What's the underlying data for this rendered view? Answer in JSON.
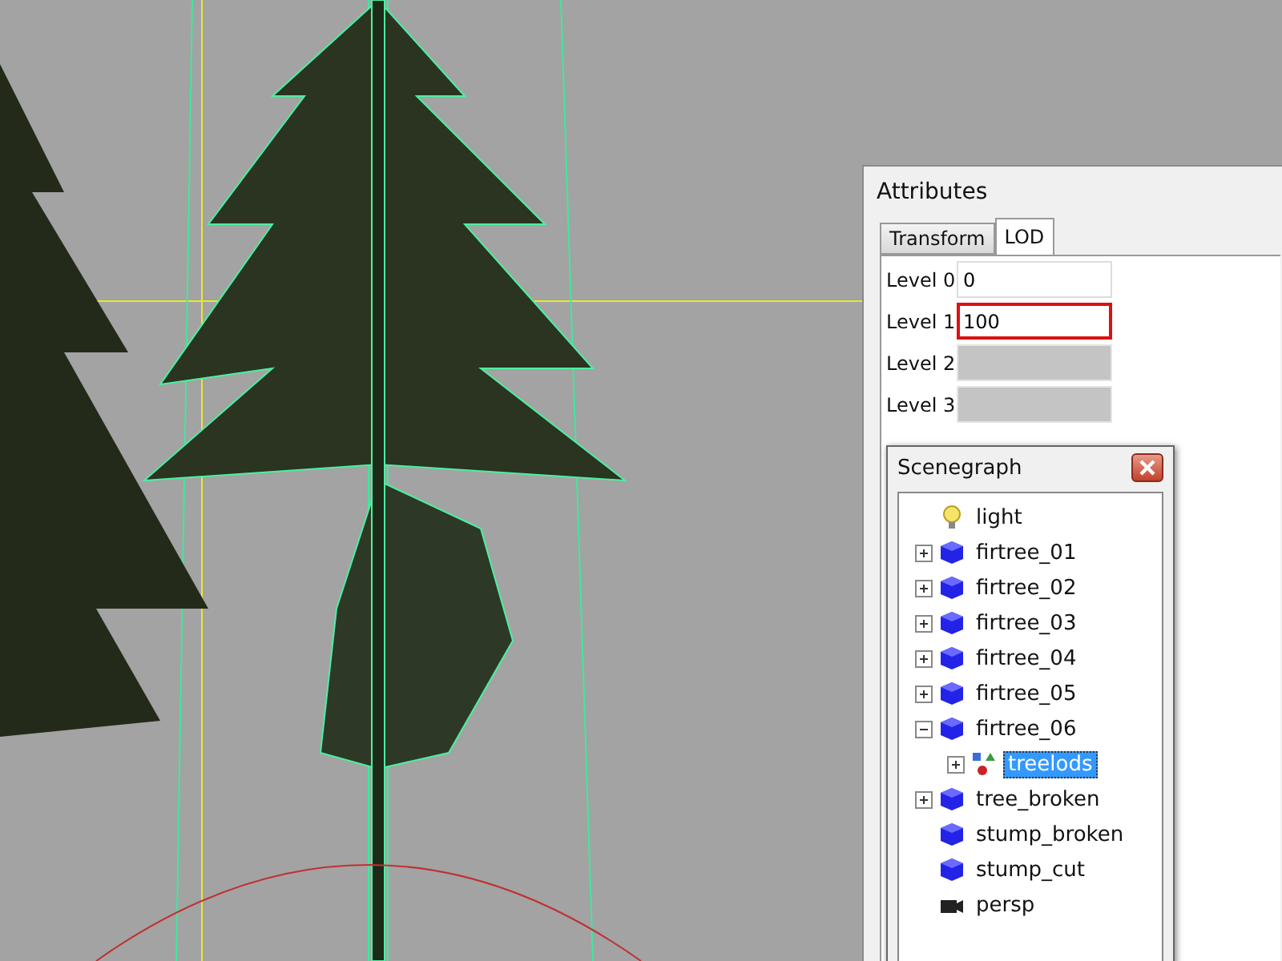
{
  "attributes": {
    "title": "Attributes",
    "tabs": [
      {
        "label": "Transform",
        "selected": false
      },
      {
        "label": "LOD",
        "selected": true
      }
    ],
    "fields": [
      {
        "label": "Level 0",
        "value": "0",
        "disabled": false,
        "highlighted": false
      },
      {
        "label": "Level 1",
        "value": "100",
        "disabled": false,
        "highlighted": true
      },
      {
        "label": "Level 2",
        "disabled": true,
        "highlighted": false
      },
      {
        "label": "Level 3",
        "disabled": true,
        "highlighted": false
      }
    ]
  },
  "scenegraph": {
    "title": "Scenegraph",
    "items": [
      {
        "label": "light",
        "kind": "light",
        "expandable": false,
        "selected": false
      },
      {
        "label": "firtree_01",
        "kind": "mesh",
        "expandable": true,
        "expanded": false,
        "selected": false
      },
      {
        "label": "firtree_02",
        "kind": "mesh",
        "expandable": true,
        "expanded": false,
        "selected": false
      },
      {
        "label": "firtree_03",
        "kind": "mesh",
        "expandable": true,
        "expanded": false,
        "selected": false
      },
      {
        "label": "firtree_04",
        "kind": "mesh",
        "expandable": true,
        "expanded": false,
        "selected": false
      },
      {
        "label": "firtree_05",
        "kind": "mesh",
        "expandable": true,
        "expanded": false,
        "selected": false
      },
      {
        "label": "firtree_06",
        "kind": "mesh",
        "expandable": true,
        "expanded": true,
        "selected": false,
        "children": [
          {
            "label": "treelods",
            "kind": "group",
            "expandable": true,
            "expanded": false,
            "selected": true
          }
        ]
      },
      {
        "label": "tree_broken",
        "kind": "mesh",
        "expandable": true,
        "expanded": false,
        "selected": false
      },
      {
        "label": "stump_broken",
        "kind": "mesh",
        "expandable": false,
        "selected": false
      },
      {
        "label": "stump_cut",
        "kind": "mesh",
        "expandable": false,
        "selected": false
      },
      {
        "label": "persp",
        "kind": "camera",
        "expandable": false,
        "selected": false
      }
    ]
  }
}
